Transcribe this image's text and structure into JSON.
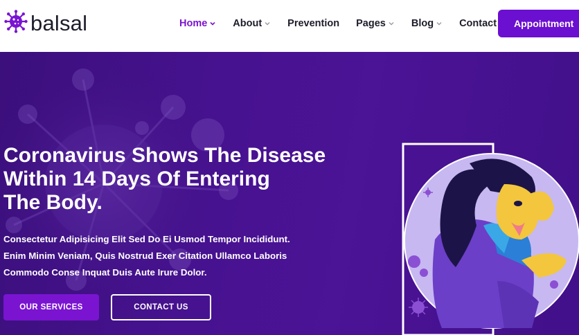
{
  "header": {
    "logo_text": "balsal",
    "logo_icon": "virus-icon",
    "nav": [
      {
        "label": "Home",
        "has_dropdown": true,
        "active": true
      },
      {
        "label": "About",
        "has_dropdown": true,
        "active": false
      },
      {
        "label": "Prevention",
        "has_dropdown": false,
        "active": false
      },
      {
        "label": "Pages",
        "has_dropdown": true,
        "active": false
      },
      {
        "label": "Blog",
        "has_dropdown": true,
        "active": false
      },
      {
        "label": "Contact",
        "has_dropdown": false,
        "active": false
      }
    ],
    "cta_label": "Appointment"
  },
  "hero": {
    "title_lines": [
      "Coronavirus Shows The Disease",
      "Within 14 Days Of Entering",
      "The Body."
    ],
    "text_lines": [
      "Consectetur Adipisicing Elit Sed Do Ei Usmod Tempor Incididunt.",
      "Enim Minim Veniam, Quis Nostrud Exer Citation Ullamco Laboris",
      "Commodo Conse Inquat Duis Aute Irure Dolor."
    ],
    "primary_button": "OUR SERVICES",
    "secondary_button": "CONTACT US"
  },
  "colors": {
    "brand": "#7a14d1",
    "hero_bg": "#45128e",
    "text_dark": "#1d1d2b"
  }
}
